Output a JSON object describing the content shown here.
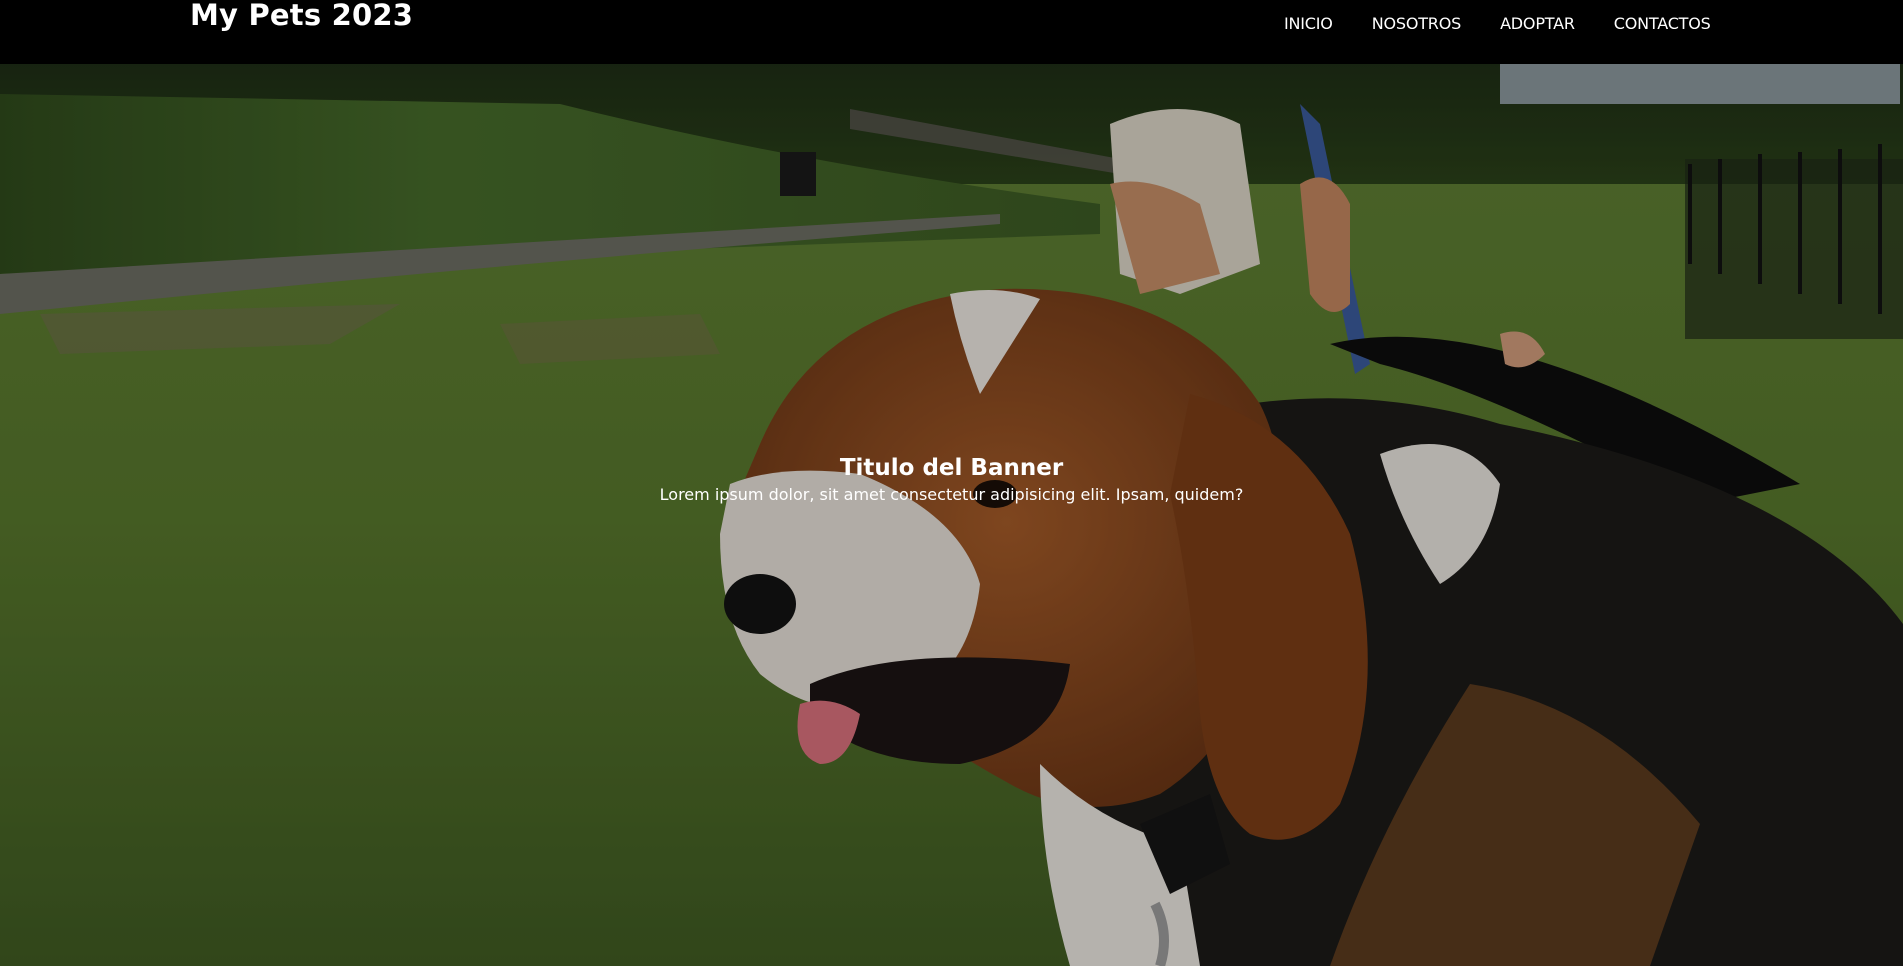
{
  "header": {
    "brand": "My Pets 2023",
    "nav": [
      {
        "label": "INICIO"
      },
      {
        "label": "NOSOTROS"
      },
      {
        "label": "ADOPTAR"
      },
      {
        "label": "CONTACTOS"
      }
    ]
  },
  "banner": {
    "title": "Titulo del Banner",
    "subtitle": "Lorem ipsum dolor, sit amet consectetur adipisicing elit. Ipsam, quidem?",
    "image_subject": "beagle dog on grass in a park with person holding blue leash"
  },
  "colors": {
    "header_bg": "#000000",
    "text": "#ffffff",
    "grass": "#4f6b2a",
    "dog_tan": "#8a4a1f"
  }
}
